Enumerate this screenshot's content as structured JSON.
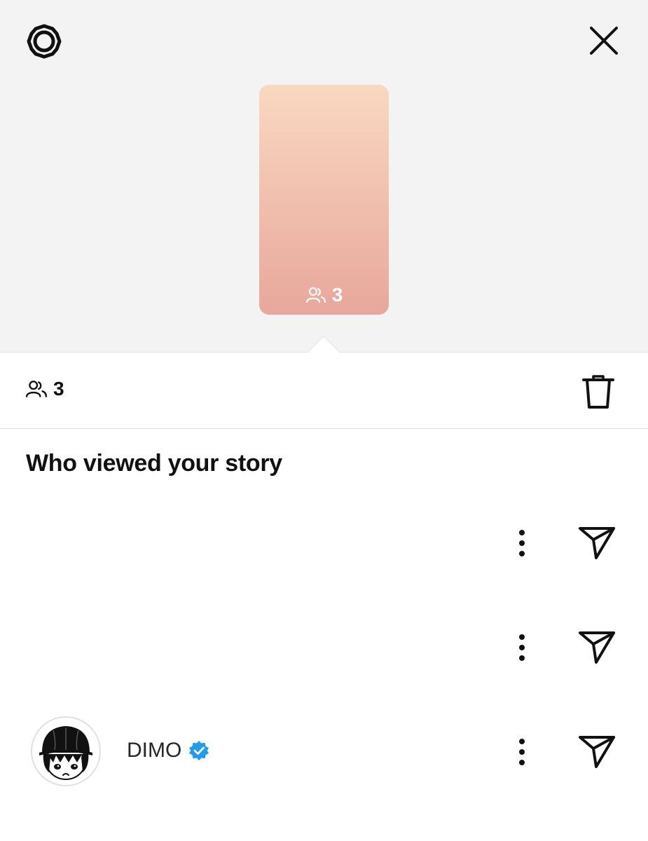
{
  "header": {
    "settings_icon": "gear-icon",
    "close_icon": "close-icon"
  },
  "story": {
    "gradient_top": "#f9d8c0",
    "gradient_bottom": "#e8a79c",
    "viewer_icon": "people-icon",
    "viewer_count": "3"
  },
  "stats": {
    "viewer_icon": "people-icon",
    "viewer_count": "3",
    "delete_icon": "trash-icon"
  },
  "viewers_section": {
    "title": "Who viewed your story",
    "viewers": [
      {
        "username": "",
        "verified": false,
        "more_icon": "more-vertical-icon",
        "send_icon": "send-icon"
      },
      {
        "username": "",
        "verified": false,
        "more_icon": "more-vertical-icon",
        "send_icon": "send-icon"
      },
      {
        "username": "DIMO",
        "verified": true,
        "verified_color": "#1f9bf0",
        "avatar": "cartoon-avatar",
        "more_icon": "more-vertical-icon",
        "send_icon": "send-icon"
      }
    ]
  }
}
